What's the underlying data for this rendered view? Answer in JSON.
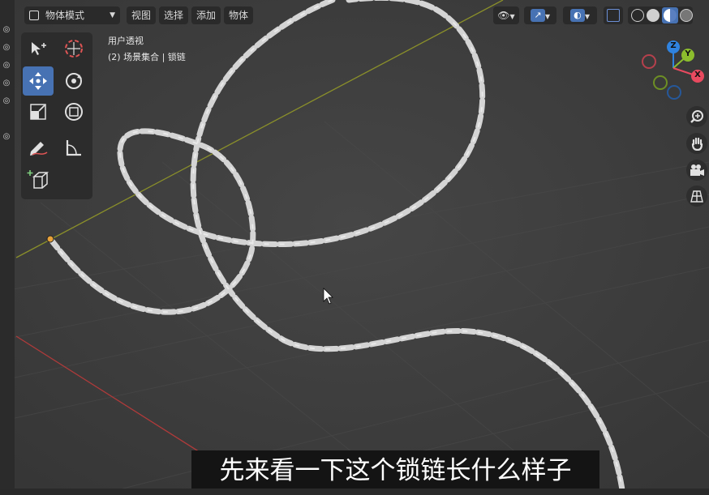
{
  "header": {
    "mode_label": "物体模式",
    "menu": [
      "视图",
      "选择",
      "添加",
      "物体"
    ]
  },
  "overlay": {
    "view_name": "用户透视",
    "collection_info": "(2) 场景集合 | 锁链"
  },
  "gizmo": {
    "axes": [
      "Z",
      "Y",
      "X"
    ],
    "colors": {
      "x": "#e84a5f",
      "y": "#8cbd2d",
      "z": "#2f83e0"
    }
  },
  "subtitle": "先来看一下这个锁链长什么样子",
  "colors": {
    "viewport_bg": "#3f3f3f",
    "active_tool": "#4772b3",
    "x_axis_line": "#b03a3a",
    "y_axis_line": "#8a8f2a"
  }
}
